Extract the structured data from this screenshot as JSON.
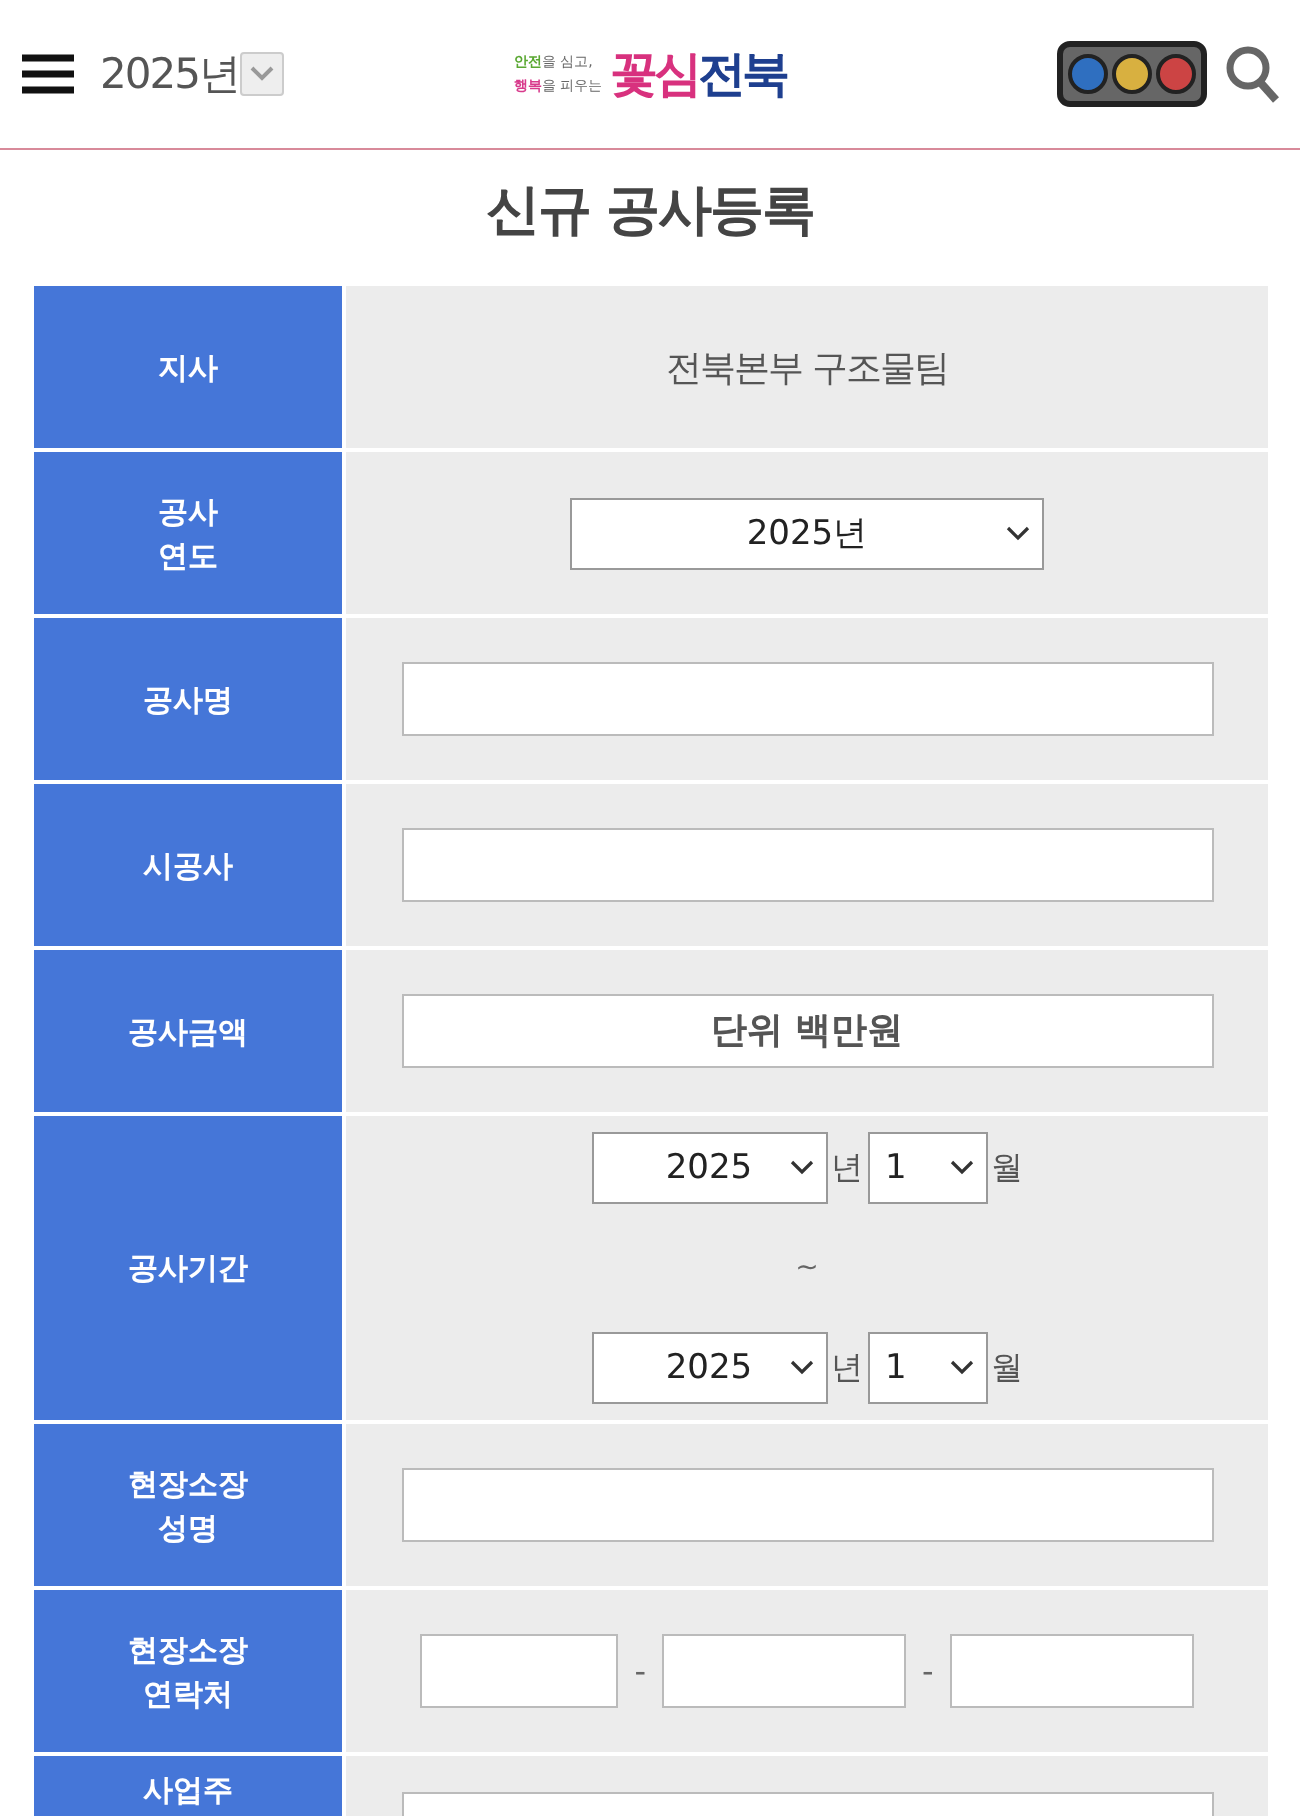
{
  "header": {
    "year_select": {
      "value": "2025년"
    },
    "logo": {
      "line_1_a": "안전",
      "line_1_b": "을 심고,",
      "line_2_a": "행복",
      "line_2_b": "을 피우는",
      "brand": "꽃심전북"
    }
  },
  "title": "신규 공사등록",
  "form_rows": [
    {
      "kind": "text",
      "label": "지사",
      "value": "전북본부 구조물팀"
    },
    {
      "kind": "select",
      "label": "공사\n연도",
      "value": "2025년"
    },
    {
      "kind": "input",
      "label": "공사명"
    },
    {
      "kind": "input",
      "label": "시공사"
    },
    {
      "kind": "input",
      "label": "공사금액",
      "placeholder": "단위 백만원"
    },
    {
      "kind": "period",
      "label": "공사기간",
      "start": {
        "year": "2025",
        "year_unit": "년",
        "month": "1",
        "month_unit": "월"
      },
      "separator": "~",
      "end": {
        "year": "2025",
        "year_unit": "년",
        "month": "1",
        "month_unit": "월"
      }
    },
    {
      "kind": "input",
      "label": "현장소장\n성명"
    },
    {
      "kind": "phone",
      "label": "현장소장\n연락처",
      "separators": [
        "-",
        "-"
      ]
    },
    {
      "kind": "input",
      "label": "사업주"
    }
  ]
}
